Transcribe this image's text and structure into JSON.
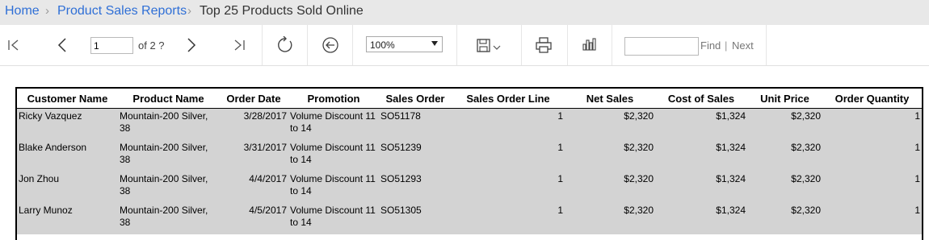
{
  "breadcrumb": {
    "home": "Home",
    "reports": "Product Sales Reports",
    "current": "Top 25 Products Sold Online"
  },
  "toolbar": {
    "page_value": "1",
    "page_of": "of 2 ?",
    "zoom": "100%",
    "find_placeholder": "",
    "find_label": "Find",
    "separator": "|",
    "next_label": "Next"
  },
  "table": {
    "headers": [
      "Customer Name",
      "Product Name",
      "Order Date",
      "Promotion",
      "Sales Order",
      "Sales Order Line",
      "Net Sales",
      "Cost of Sales",
      "Unit Price",
      "Order Quantity"
    ],
    "rows": [
      {
        "customer": "Ricky Vazquez",
        "product": "Mountain-200 Silver, 38",
        "date": "3/28/2017",
        "promotion": "Volume Discount 11 to 14",
        "order": "SO51178",
        "line": "1",
        "net": "$2,320",
        "cost": "$1,324",
        "price": "$2,320",
        "qty": "1"
      },
      {
        "customer": "Blake Anderson",
        "product": "Mountain-200 Silver, 38",
        "date": "3/31/2017",
        "promotion": "Volume Discount 11 to 14",
        "order": "SO51239",
        "line": "1",
        "net": "$2,320",
        "cost": "$1,324",
        "price": "$2,320",
        "qty": "1"
      },
      {
        "customer": "Jon Zhou",
        "product": "Mountain-200 Silver, 38",
        "date": "4/4/2017",
        "promotion": "Volume Discount 11 to 14",
        "order": "SO51293",
        "line": "1",
        "net": "$2,320",
        "cost": "$1,324",
        "price": "$2,320",
        "qty": "1"
      },
      {
        "customer": "Larry Munoz",
        "product": "Mountain-200 Silver, 38",
        "date": "4/5/2017",
        "promotion": "Volume Discount 11 to 14",
        "order": "SO51305",
        "line": "1",
        "net": "$2,320",
        "cost": "$1,324",
        "price": "$2,320",
        "qty": "1"
      }
    ]
  },
  "colors": {
    "link": "#2f6fd6",
    "breadcrumb_bg": "#e8e8e8",
    "row_bg": "#d3d3d3"
  },
  "icons": [
    "first-page-icon",
    "previous-page-icon",
    "next-page-icon",
    "last-page-icon",
    "refresh-icon",
    "back-icon",
    "save-icon",
    "print-icon",
    "powerbi-icon"
  ]
}
